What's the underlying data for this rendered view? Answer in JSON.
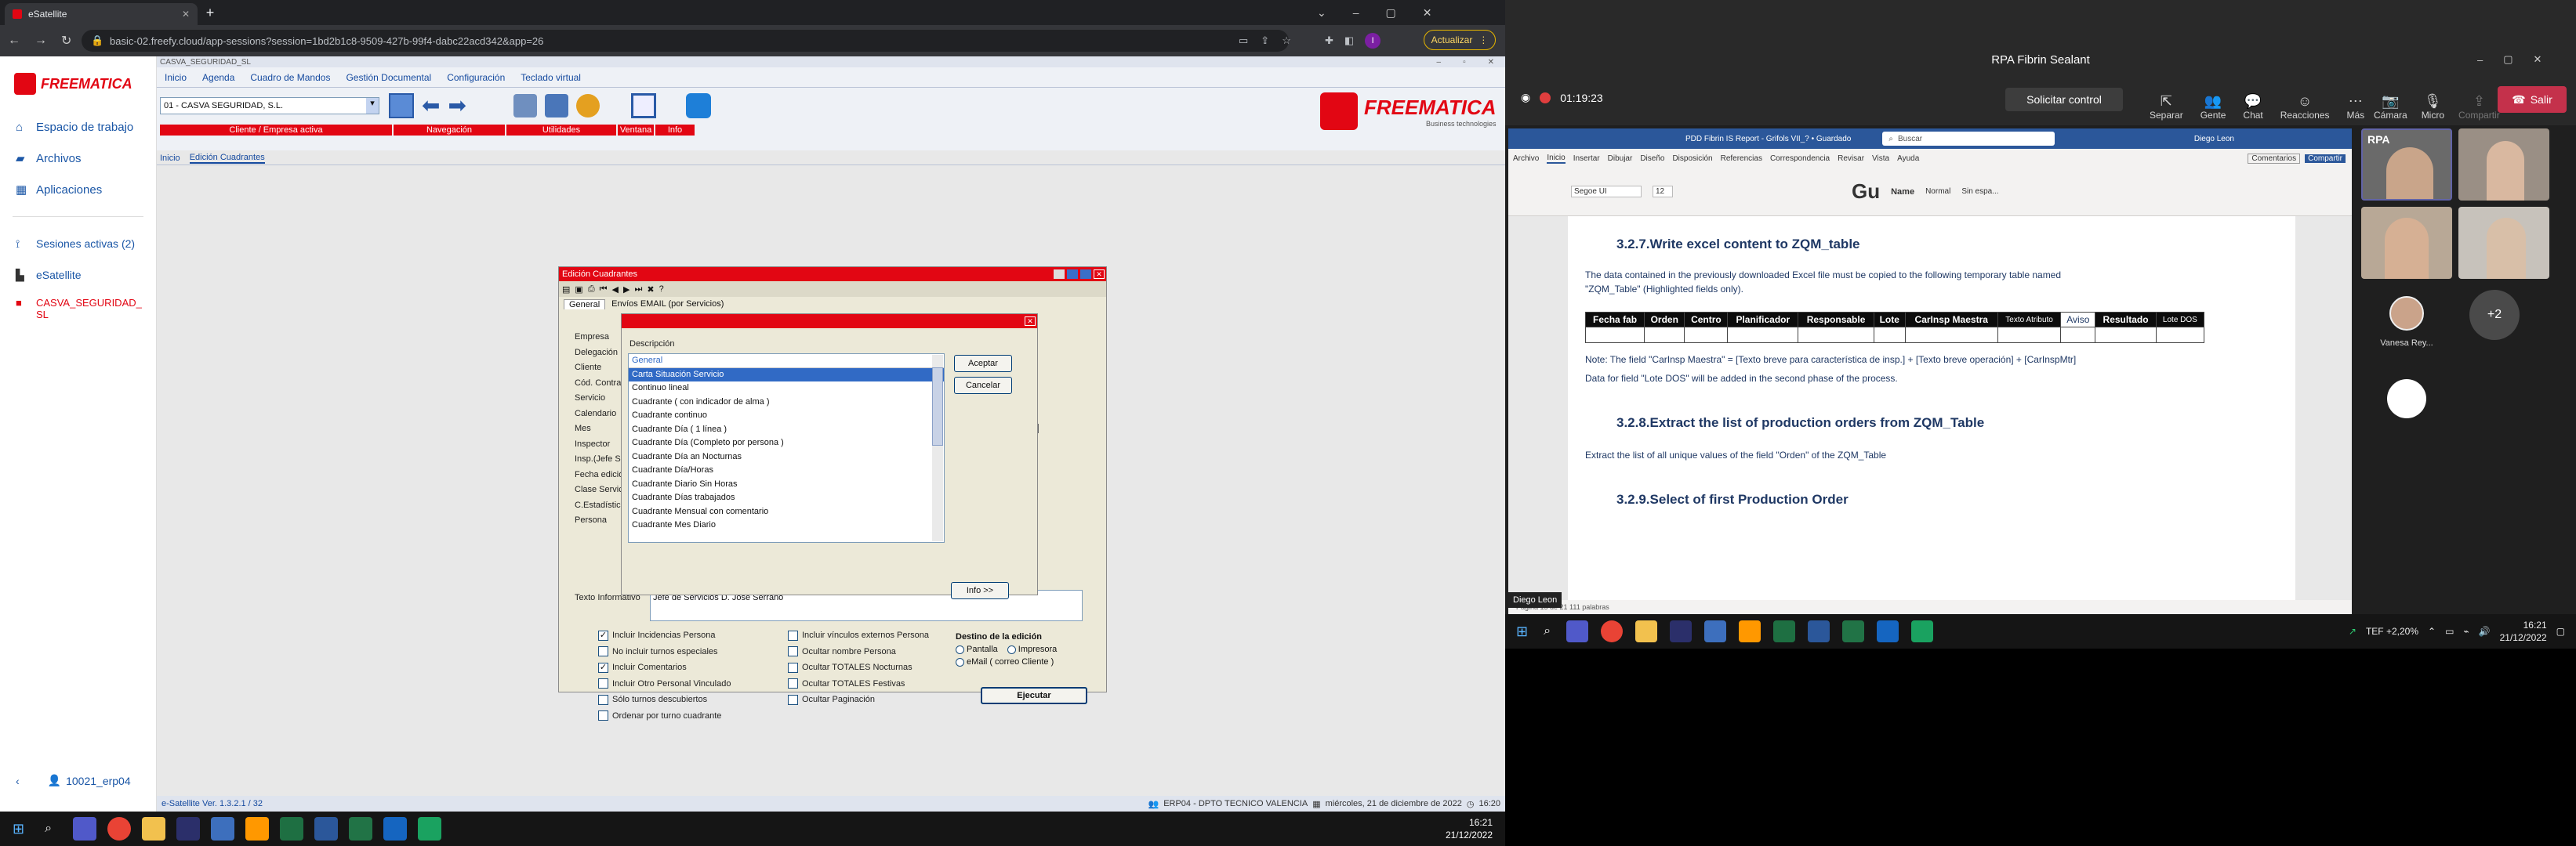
{
  "browser": {
    "tab_title": "eSatellite",
    "url": "basic-02.freefy.cloud/app-sessions?session=1bd2b1c8-9509-427b-99f4-dabc22acd342&app=26",
    "update_label": "Actualizar"
  },
  "esat": {
    "logo": "FREEMATICA",
    "nav": [
      "Espacio de trabajo",
      "Archivos",
      "Aplicaciones"
    ],
    "sessions_label": "Sesiones activas (2)",
    "sessions": [
      "eSatellite",
      "CASVA_SEGURIDAD_ SL"
    ],
    "user": "10021_erp04"
  },
  "app": {
    "window_title": "CASVA_SEGURIDAD_SL",
    "menu": [
      "Inicio",
      "Agenda",
      "Cuadro de Mandos",
      "Gestión Documental",
      "Configuración",
      "Teclado virtual"
    ],
    "company_select": "01 - CASVA SEGURIDAD, S.L.",
    "red_labels": [
      "Cliente / Empresa activa",
      "Navegación",
      "Utilidades",
      "Ventana",
      "Info"
    ],
    "tabs": [
      "Inicio",
      "Edición Cuadrantes"
    ],
    "logo": "FREEMATICA",
    "logo_sub": "Business technologies",
    "status_left": "e-Satellite Ver. 1.3.2.1 / 32",
    "status_user": "ERP04 - DPTO TECNICO VALENCIA",
    "status_date": "miércoles, 21 de diciembre de 2022",
    "status_time": "16:20"
  },
  "dlg": {
    "title": "Edición Cuadrantes",
    "tabs": [
      "General",
      "Envíos EMAIL (por Servicios)"
    ],
    "fields": [
      "Empresa",
      "Delegación",
      "Cliente",
      "Cód. Contrat",
      "Servicio",
      "Calendario",
      "Mes",
      "Inspector",
      "Insp.(Jefe Se",
      "Fecha edició",
      "Clase Servic",
      "C.Estadístico",
      "Persona"
    ],
    "texto_label": "Texto Informativo",
    "texto_value": "Jefe de Servicios D. José Serrano",
    "checks_left": [
      {
        "label": "Incluir Incidencias Persona",
        "on": true
      },
      {
        "label": "No incluir turnos especiales",
        "on": false
      },
      {
        "label": "Incluir Comentarios",
        "on": true
      },
      {
        "label": "Incluir Otro Personal Vinculado",
        "on": false
      },
      {
        "label": "Sólo turnos descubiertos",
        "on": false
      },
      {
        "label": "Ordenar por turno cuadrante",
        "on": false
      }
    ],
    "checks_mid": [
      "Incluir vínculos externos Persona",
      "Ocultar nombre Persona",
      "Ocultar TOTALES Nocturnas",
      "Ocultar TOTALES Festivas",
      "Ocultar Paginación"
    ],
    "dest_title": "Destino de la edición",
    "dest": [
      "Pantalla",
      "Impresora",
      "eMail ( correo Cliente )"
    ],
    "run": "Ejecutar"
  },
  "popup": {
    "header": "Descripción",
    "group": "General",
    "items": [
      "Carta Situación Servicio",
      "Continuo lineal",
      "Cuadrante ( con indicador de alma )",
      "Cuadrante continuo",
      "Cuadrante Día ( 1 línea )",
      "Cuadrante Día (Completo por persona )",
      "Cuadrante Día an Nocturnas",
      "Cuadrante Día/Horas",
      "Cuadrante Diario Sin Horas",
      "Cuadrante Días trabajados",
      "Cuadrante Mensual con comentario",
      "Cuadrante Mes Diario"
    ],
    "ok": "Aceptar",
    "cancel": "Cancelar",
    "info": "Info >>"
  },
  "taskbar_left": {
    "time": "16:21",
    "date": "21/12/2022"
  },
  "teams": {
    "title": "RPA Fibrin Sealant",
    "timer": "01:19:23",
    "request": "Solicitar control",
    "tools": [
      "Separar",
      "Gente",
      "Chat",
      "Reacciones",
      "Más"
    ],
    "media": [
      "Cámara",
      "Micro",
      "Compartir"
    ],
    "leave": "Salir",
    "participant": "Vanesa Rey...",
    "more": "+2",
    "presenter": "Diego Leon"
  },
  "word": {
    "doc_title": "PDD Fibrin IS Report - Grifols VII_? • Guardado",
    "search": "Buscar",
    "user": "Diego Leon",
    "menu": [
      "Archivo",
      "Inicio",
      "Insertar",
      "Dibujar",
      "Diseño",
      "Disposición",
      "Referencias",
      "Correspondencia",
      "Revisar",
      "Vista",
      "Ayuda"
    ],
    "comments": "Comentarios",
    "share": "Compartir",
    "font": "Segoe UI",
    "size": "12",
    "styles": [
      "Name",
      "Normal",
      "Sin espa..."
    ],
    "h327": "3.2.7.Write excel content to ZQM_table",
    "p327": "The data contained in the previously downloaded Excel file must be copied to the following temporary table named \"ZQM_Table\" (Highlighted fields only).",
    "cols": [
      "Fecha fab",
      "Orden",
      "Centro",
      "Planificador",
      "Responsable",
      "Lote",
      "CarInsp Maestra",
      "Texto Atributo",
      "Aviso",
      "Resultado",
      "Lote DOS"
    ],
    "note": "Note: The field \"CarInsp Maestra\" = [Texto breve para característica de insp.] + [Texto breve operación] + [CarInspMtr]",
    "p_lote": "Data for field \"Lote DOS\" will be added in the second phase of the process.",
    "h328": "3.2.8.Extract the list of production orders from ZQM_Table",
    "p328": "Extract the list of all unique values of the field \"Orden\" of the ZQM_Table",
    "h329": "3.2.9.Select of first Production Order",
    "status": "Página 15 de 21   111 palabras"
  },
  "taskbar_right": {
    "time": "16:21",
    "date": "21/12/2022",
    "ticker": "TEF +2,20%"
  },
  "colors": {
    "red": "#e20613",
    "teams_bg": "#1f1f1f",
    "word_heading": "#1f3864"
  }
}
